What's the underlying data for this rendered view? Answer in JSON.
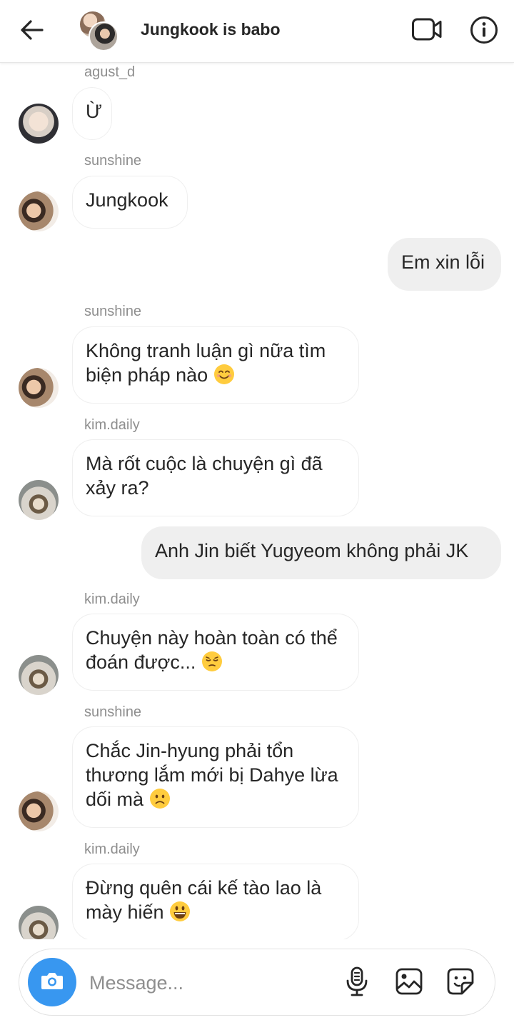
{
  "header": {
    "title": "Jungkook is babo",
    "back_icon": "arrow-left-icon",
    "video_icon": "video-camera-icon",
    "info_icon": "info-icon"
  },
  "messages": [
    {
      "sender": "agust_d",
      "direction": "in",
      "text": "Ừ"
    },
    {
      "sender": "sunshine",
      "direction": "in",
      "text": "Jungkook"
    },
    {
      "sender": "",
      "direction": "out",
      "text": "Em xin lỗi"
    },
    {
      "sender": "sunshine",
      "direction": "in",
      "text": "Không tranh luận gì nữa tìm biện pháp nào",
      "emoji": "smiling-face-emoji"
    },
    {
      "sender": "kim.daily",
      "direction": "in",
      "text": "Mà rốt cuộc là chuyện gì đã xảy ra?"
    },
    {
      "sender": "",
      "direction": "out",
      "text": "Anh Jin biết Yugyeom không phải JK"
    },
    {
      "sender": "kim.daily",
      "direction": "in",
      "text": "Chuyện này hoàn toàn có thể đoán được...",
      "emoji": "pensive-face-emoji"
    },
    {
      "sender": "sunshine",
      "direction": "in",
      "text": "Chắc Jin-hyung phải tổn thương lắm mới bị Dahye lừa dối mà",
      "emoji": "frowning-face-emoji"
    },
    {
      "sender": "kim.daily",
      "direction": "in",
      "text": "Đừng quên cái kế tào lao là mày hiến",
      "emoji": "grinning-face-emoji"
    }
  ],
  "composer": {
    "placeholder": "Message...",
    "camera_icon": "camera-icon",
    "mic_icon": "microphone-icon",
    "gallery_icon": "image-icon",
    "sticker_icon": "sticker-icon"
  },
  "colors": {
    "accent": "#3897f0",
    "outgoing_bubble": "#efefef",
    "secondary_text": "#8e8e8e"
  }
}
